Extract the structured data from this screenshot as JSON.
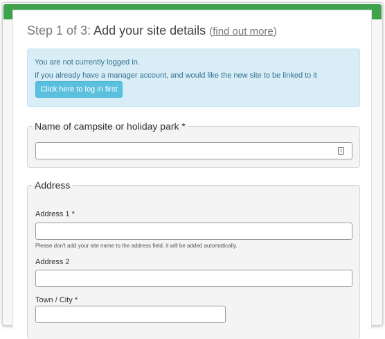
{
  "header": {
    "step": "Step 1 of 3:",
    "title": "Add your site details",
    "find_out_more": "find out more",
    "paren_open": "(",
    "paren_close": ")"
  },
  "alert": {
    "not_logged_in": "You are not currently logged in.",
    "manager_text": "If you already have a manager account, and would like the new site to be linked to it",
    "login_button": "Click here to log in first"
  },
  "name_section": {
    "legend": "Name of campsite or holiday park *",
    "value": "",
    "icon": "autofill-key-icon"
  },
  "address_section": {
    "legend": "Address",
    "address1_label": "Address 1 *",
    "address1_value": "",
    "address1_help": "Please don't add your site name to the address field, it will be added automatically.",
    "address2_label": "Address 2",
    "address2_value": "",
    "town_label": "Town / City *",
    "town_value": ""
  },
  "colors": {
    "brand_green": "#3fa34d",
    "info_bg": "#d9edf7",
    "info_button": "#5bc0de"
  }
}
